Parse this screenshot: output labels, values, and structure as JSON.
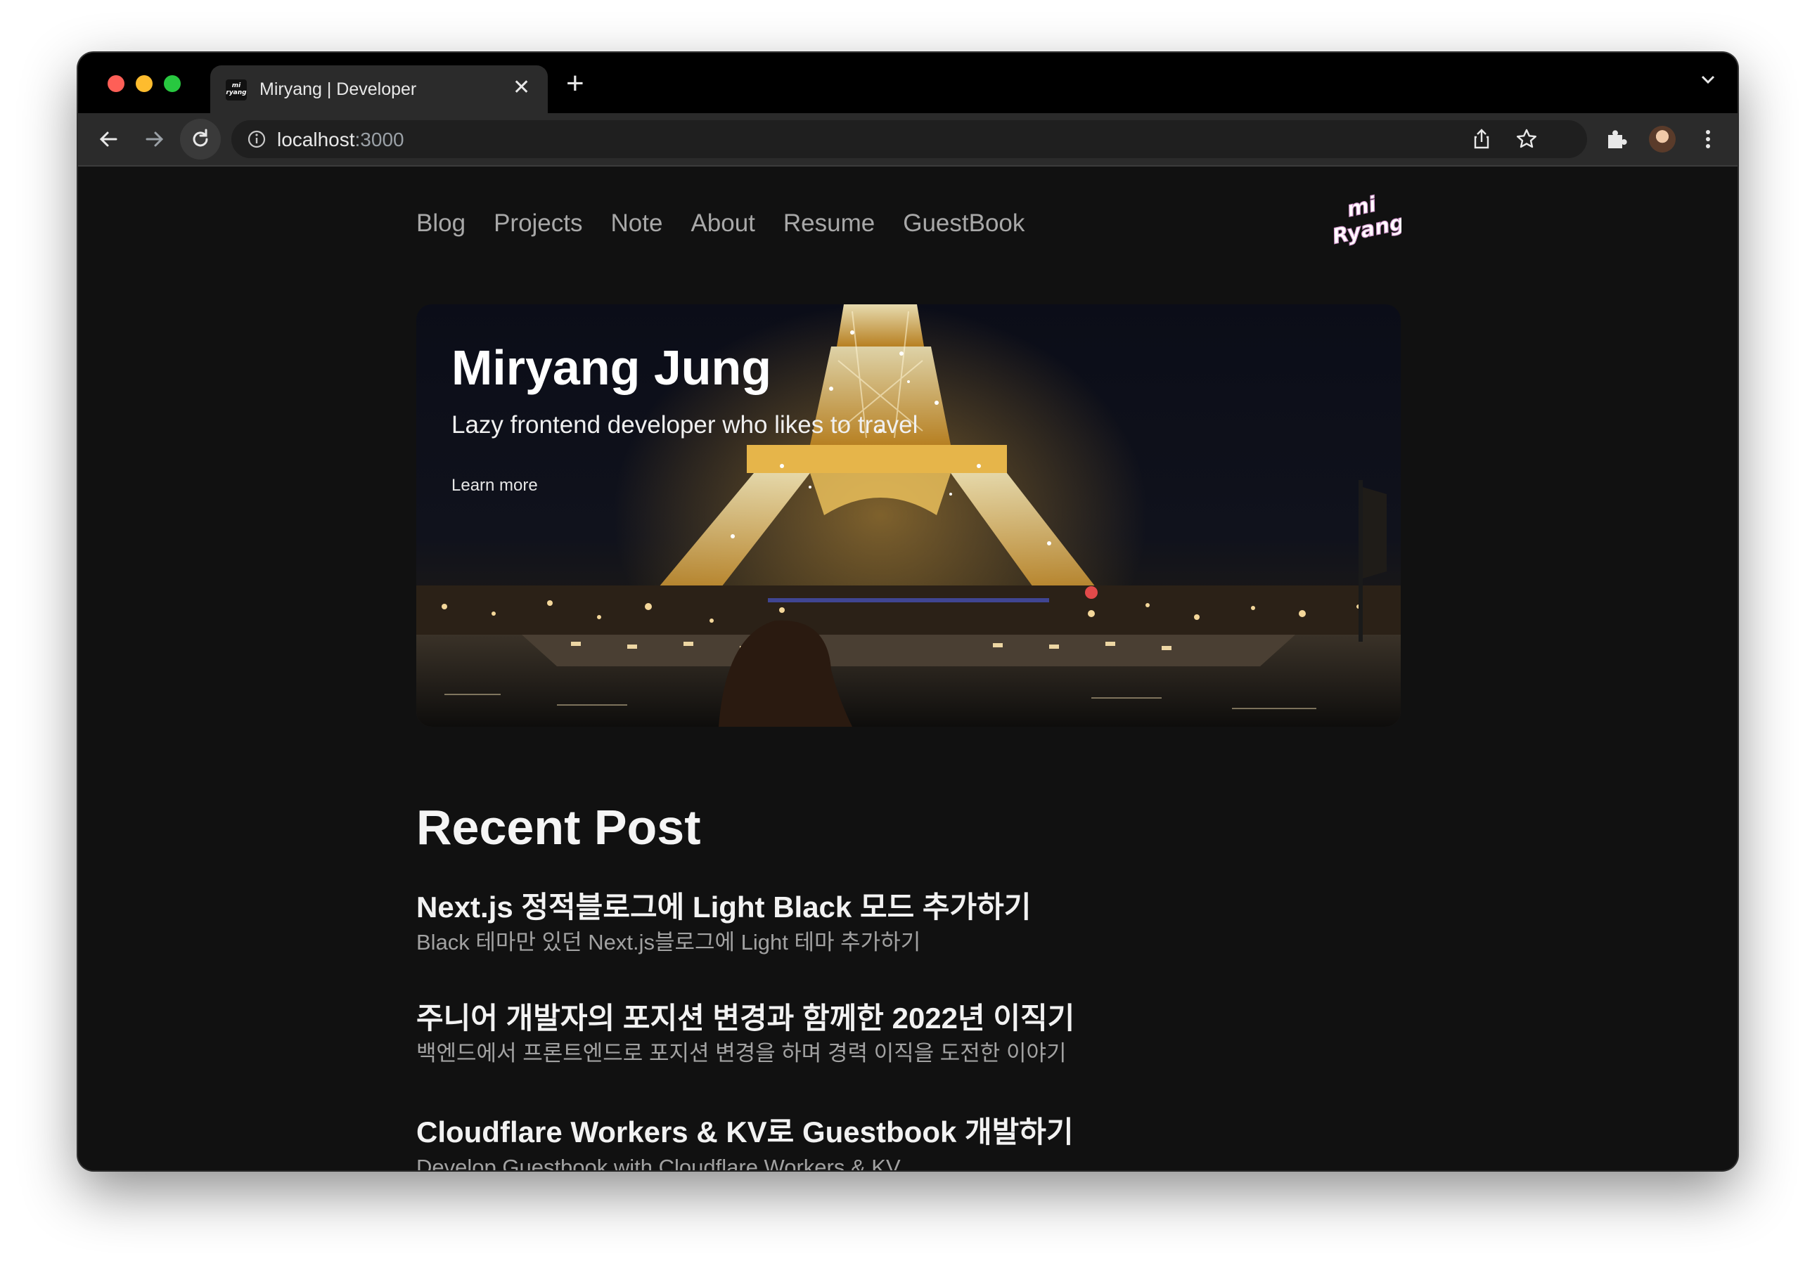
{
  "browser": {
    "tab": {
      "favicon_text": "mi ryang",
      "title": "Miryang | Developer"
    },
    "url": {
      "host": "localhost",
      "port": ":3000"
    }
  },
  "nav": {
    "items": [
      "Blog",
      "Projects",
      "Note",
      "About",
      "Resume",
      "GuestBook"
    ],
    "logo_text": [
      "mi",
      "Ryang"
    ]
  },
  "hero": {
    "title": "Miryang Jung",
    "subtitle": "Lazy frontend developer who likes to travel",
    "cta": "Learn more"
  },
  "recent": {
    "heading": "Recent Post",
    "posts": [
      {
        "title": "Next.js 정적블로그에 Light Black 모드 추가하기",
        "desc": "Black 테마만 있던 Next.js블로그에 Light 테마 추가하기"
      },
      {
        "title": "주니어 개발자의 포지션 변경과 함께한 2022년 이직기",
        "desc": "백엔드에서 프론트엔드로 포지션 변경을 하며 경력 이직을 도전한 이야기"
      },
      {
        "title": "Cloudflare Workers & KV로 Guestbook 개발하기",
        "desc": "Develop Guestbook with Cloudflare Workers & KV"
      }
    ]
  },
  "colors": {
    "page_bg": "#111111",
    "chrome_tabstrip": "#000000",
    "chrome_toolbar": "#2b2b2b",
    "nav_text": "#a8a8a8",
    "post_desc": "#a2a2a2"
  },
  "icons": [
    "close-icon",
    "plus-icon",
    "chevron-down-icon",
    "back-arrow-icon",
    "forward-arrow-icon",
    "reload-icon",
    "info-icon",
    "share-icon",
    "star-icon",
    "puzzle-extension-icon",
    "more-vert-icon"
  ]
}
